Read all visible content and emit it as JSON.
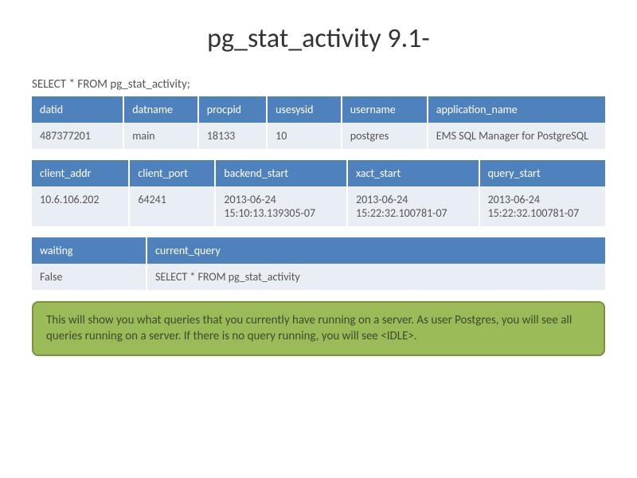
{
  "title": "pg_stat_activity 9.1-",
  "query": "SELECT * FROM pg_stat_activity;",
  "table1": {
    "headers": [
      "datid",
      "datname",
      "procpid",
      "usesysid",
      "username",
      "application_name"
    ],
    "row": [
      "487377201",
      "main",
      "18133",
      "10",
      "postgres",
      "EMS SQL Manager for PostgreSQL"
    ]
  },
  "table2": {
    "headers": [
      "client_addr",
      "client_port",
      "backend_start",
      "xact_start",
      "query_start"
    ],
    "row": [
      "10.6.106.202",
      "64241",
      "2013-06-24 15:10:13.139305-07",
      "2013-06-24 15:22:32.100781-07",
      "2013-06-24 15:22:32.100781-07"
    ]
  },
  "table3": {
    "headers": [
      "waiting",
      "current_query"
    ],
    "row": [
      "False",
      "SELECT * FROM pg_stat_activity"
    ]
  },
  "note": "This will show you what queries that you currently have running on a server. As user Postgres, you will see all queries running on a server. If there is no query running, you will see <IDLE>."
}
